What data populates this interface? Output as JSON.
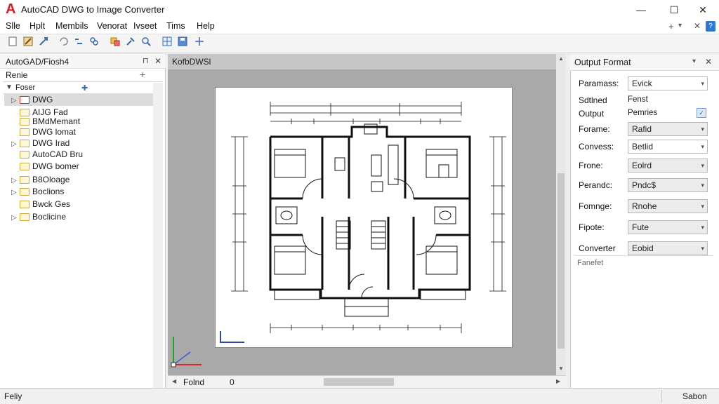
{
  "window": {
    "title": "AutoCAD DWG to Image Converter",
    "logo": "A",
    "minimize": "—",
    "maximize": "☐",
    "close": "✕"
  },
  "menu": [
    "Slle",
    "Hplt",
    "Membils",
    "Venorat",
    "Ivseet",
    "Tims",
    "Help"
  ],
  "menu_right": {
    "plus": "+",
    "down": "▾",
    "close": "✕",
    "help": "?"
  },
  "toolbar": {
    "icons": [
      "new-icon",
      "edit-icon",
      "wand-icon",
      "undo-icon",
      "link-icon",
      "layers-icon",
      "select-icon",
      "tool-icon",
      "zoom-icon",
      "grid-icon",
      "save-icon",
      "move-icon"
    ]
  },
  "left_panel": {
    "title": "AutoGAD/Fiosh4",
    "pin": "⊓",
    "close": "✕",
    "subtitle": "Renie",
    "add": "+",
    "root": "Foser",
    "items": [
      {
        "label": "DWG",
        "expand": "▷",
        "red": true,
        "selected": true
      },
      {
        "label": "AIJG Fad",
        "expand": "",
        "red": false,
        "selected": false
      },
      {
        "label": "BMdMemant",
        "expand": "",
        "red": false,
        "selected": false
      },
      {
        "label": "DWG lomat",
        "expand": "",
        "red": false,
        "selected": false
      },
      {
        "label": "DWG Irad",
        "expand": "▷",
        "red": false,
        "selected": false
      },
      {
        "label": "AutoCAD Bru",
        "expand": "",
        "red": false,
        "selected": false
      },
      {
        "label": "DWG bomer",
        "expand": "",
        "red": false,
        "selected": false
      },
      {
        "label": "B8Oloage",
        "expand": "▷",
        "red": false,
        "selected": false
      },
      {
        "label": "Boclions",
        "expand": "▷",
        "red": false,
        "selected": false
      },
      {
        "label": "Bwck Ges",
        "expand": "",
        "red": false,
        "selected": false
      },
      {
        "label": "Boclicine",
        "expand": "▷",
        "red": false,
        "selected": false
      }
    ]
  },
  "canvas": {
    "tab_title": "KofbDWSl",
    "sheet_label": "Folnd",
    "coord": "0"
  },
  "right_panel": {
    "title": "Output Format",
    "down": "▾",
    "close": "✕",
    "rows": [
      {
        "label": "Paramass:",
        "value": "Evick",
        "field": "white"
      },
      {
        "label": "Sdtlned",
        "value": "Fenst",
        "field": "none"
      },
      {
        "label": "Output",
        "value": "Pemries",
        "field": "check"
      },
      {
        "label": "Forame:",
        "value": "Rafid",
        "field": "grey"
      },
      {
        "label": "Convess:",
        "value": "Betlid",
        "field": "white"
      },
      {
        "label": "Frone:",
        "value": "Eolrd",
        "field": "grey"
      },
      {
        "label": "Perandc:",
        "value": "Pndc$",
        "field": "grey"
      },
      {
        "label": "Fomnge:",
        "value": "Rnohe",
        "field": "grey"
      },
      {
        "label": "Fipote:",
        "value": "Fute",
        "field": "grey"
      },
      {
        "label": "Converter",
        "value": "Eobid",
        "field": "grey"
      }
    ],
    "footer": "Fanefet"
  },
  "status": {
    "left": "Feliy",
    "right": "Sabon"
  }
}
